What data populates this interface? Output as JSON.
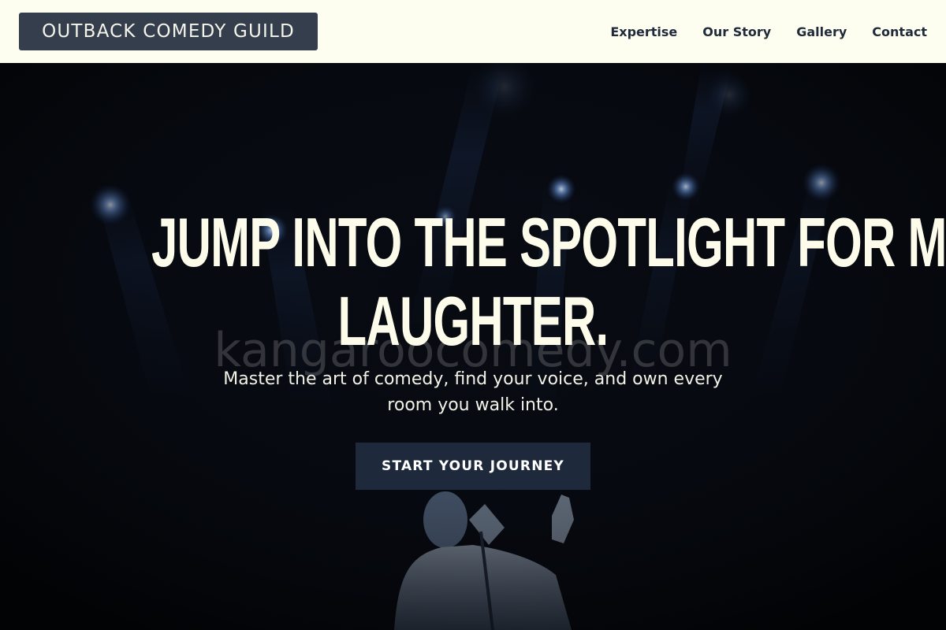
{
  "header": {
    "brand": "OUTBACK COMEDY GUILD",
    "nav": [
      {
        "label": "Expertise"
      },
      {
        "label": "Our Story"
      },
      {
        "label": "Gallery"
      },
      {
        "label": "Contact"
      }
    ]
  },
  "hero": {
    "title_line1": "JUMP INTO THE SPOTLIGHT FOR MASSIVE",
    "title_line2": "LAUGHTER.",
    "watermark": "kangaroocomedy.com",
    "subtitle": "Master the art of comedy, find your voice, and own every room you walk into.",
    "cta_label": "START YOUR JOURNEY",
    "background_image": "stage-performer-spotlights"
  },
  "colors": {
    "header_bg": "#fdfdf0",
    "brand_bg": "#343e4d",
    "nav_text": "#1f2a3a",
    "hero_text": "#fdfcea",
    "cta_bg": "#1e293b",
    "spotlight": "#7aa6e8"
  }
}
